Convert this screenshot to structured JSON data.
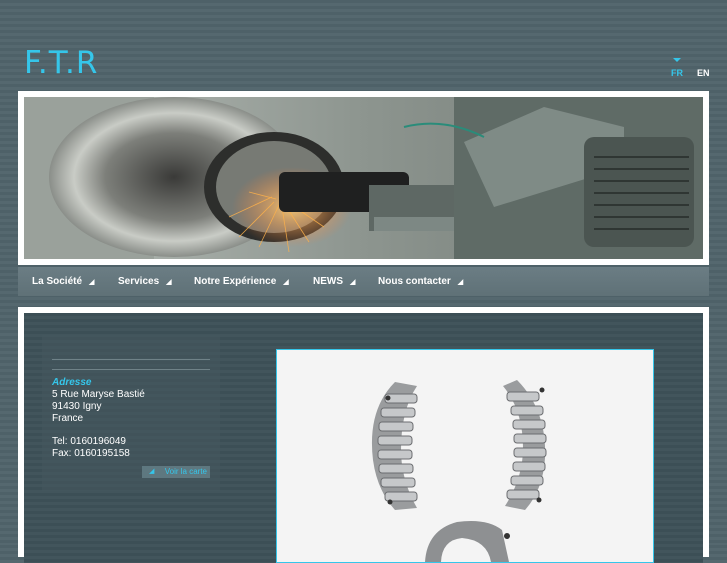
{
  "header": {
    "logo": "F.T.R",
    "languages": [
      {
        "code": "FR",
        "active": true
      },
      {
        "code": "EN",
        "active": false
      }
    ],
    "accent_color": "#35c6ea"
  },
  "nav": {
    "items": [
      {
        "label": "La Société"
      },
      {
        "label": "Services"
      },
      {
        "label": "Notre Expérience"
      },
      {
        "label": "NEWS"
      },
      {
        "label": "Nous contacter"
      }
    ],
    "arrow": "◢"
  },
  "address": {
    "title": "Adresse",
    "street": "5 Rue Maryse Bastié",
    "city": "91430 Igny",
    "country": "France",
    "tel": "Tel: 0160196049",
    "fax": "Fax: 0160195158",
    "map_link": "Voir la carte"
  },
  "banner": {
    "icon": "grinding-machine-photo"
  },
  "photo": {
    "icon": "bearing-parts-photo"
  }
}
